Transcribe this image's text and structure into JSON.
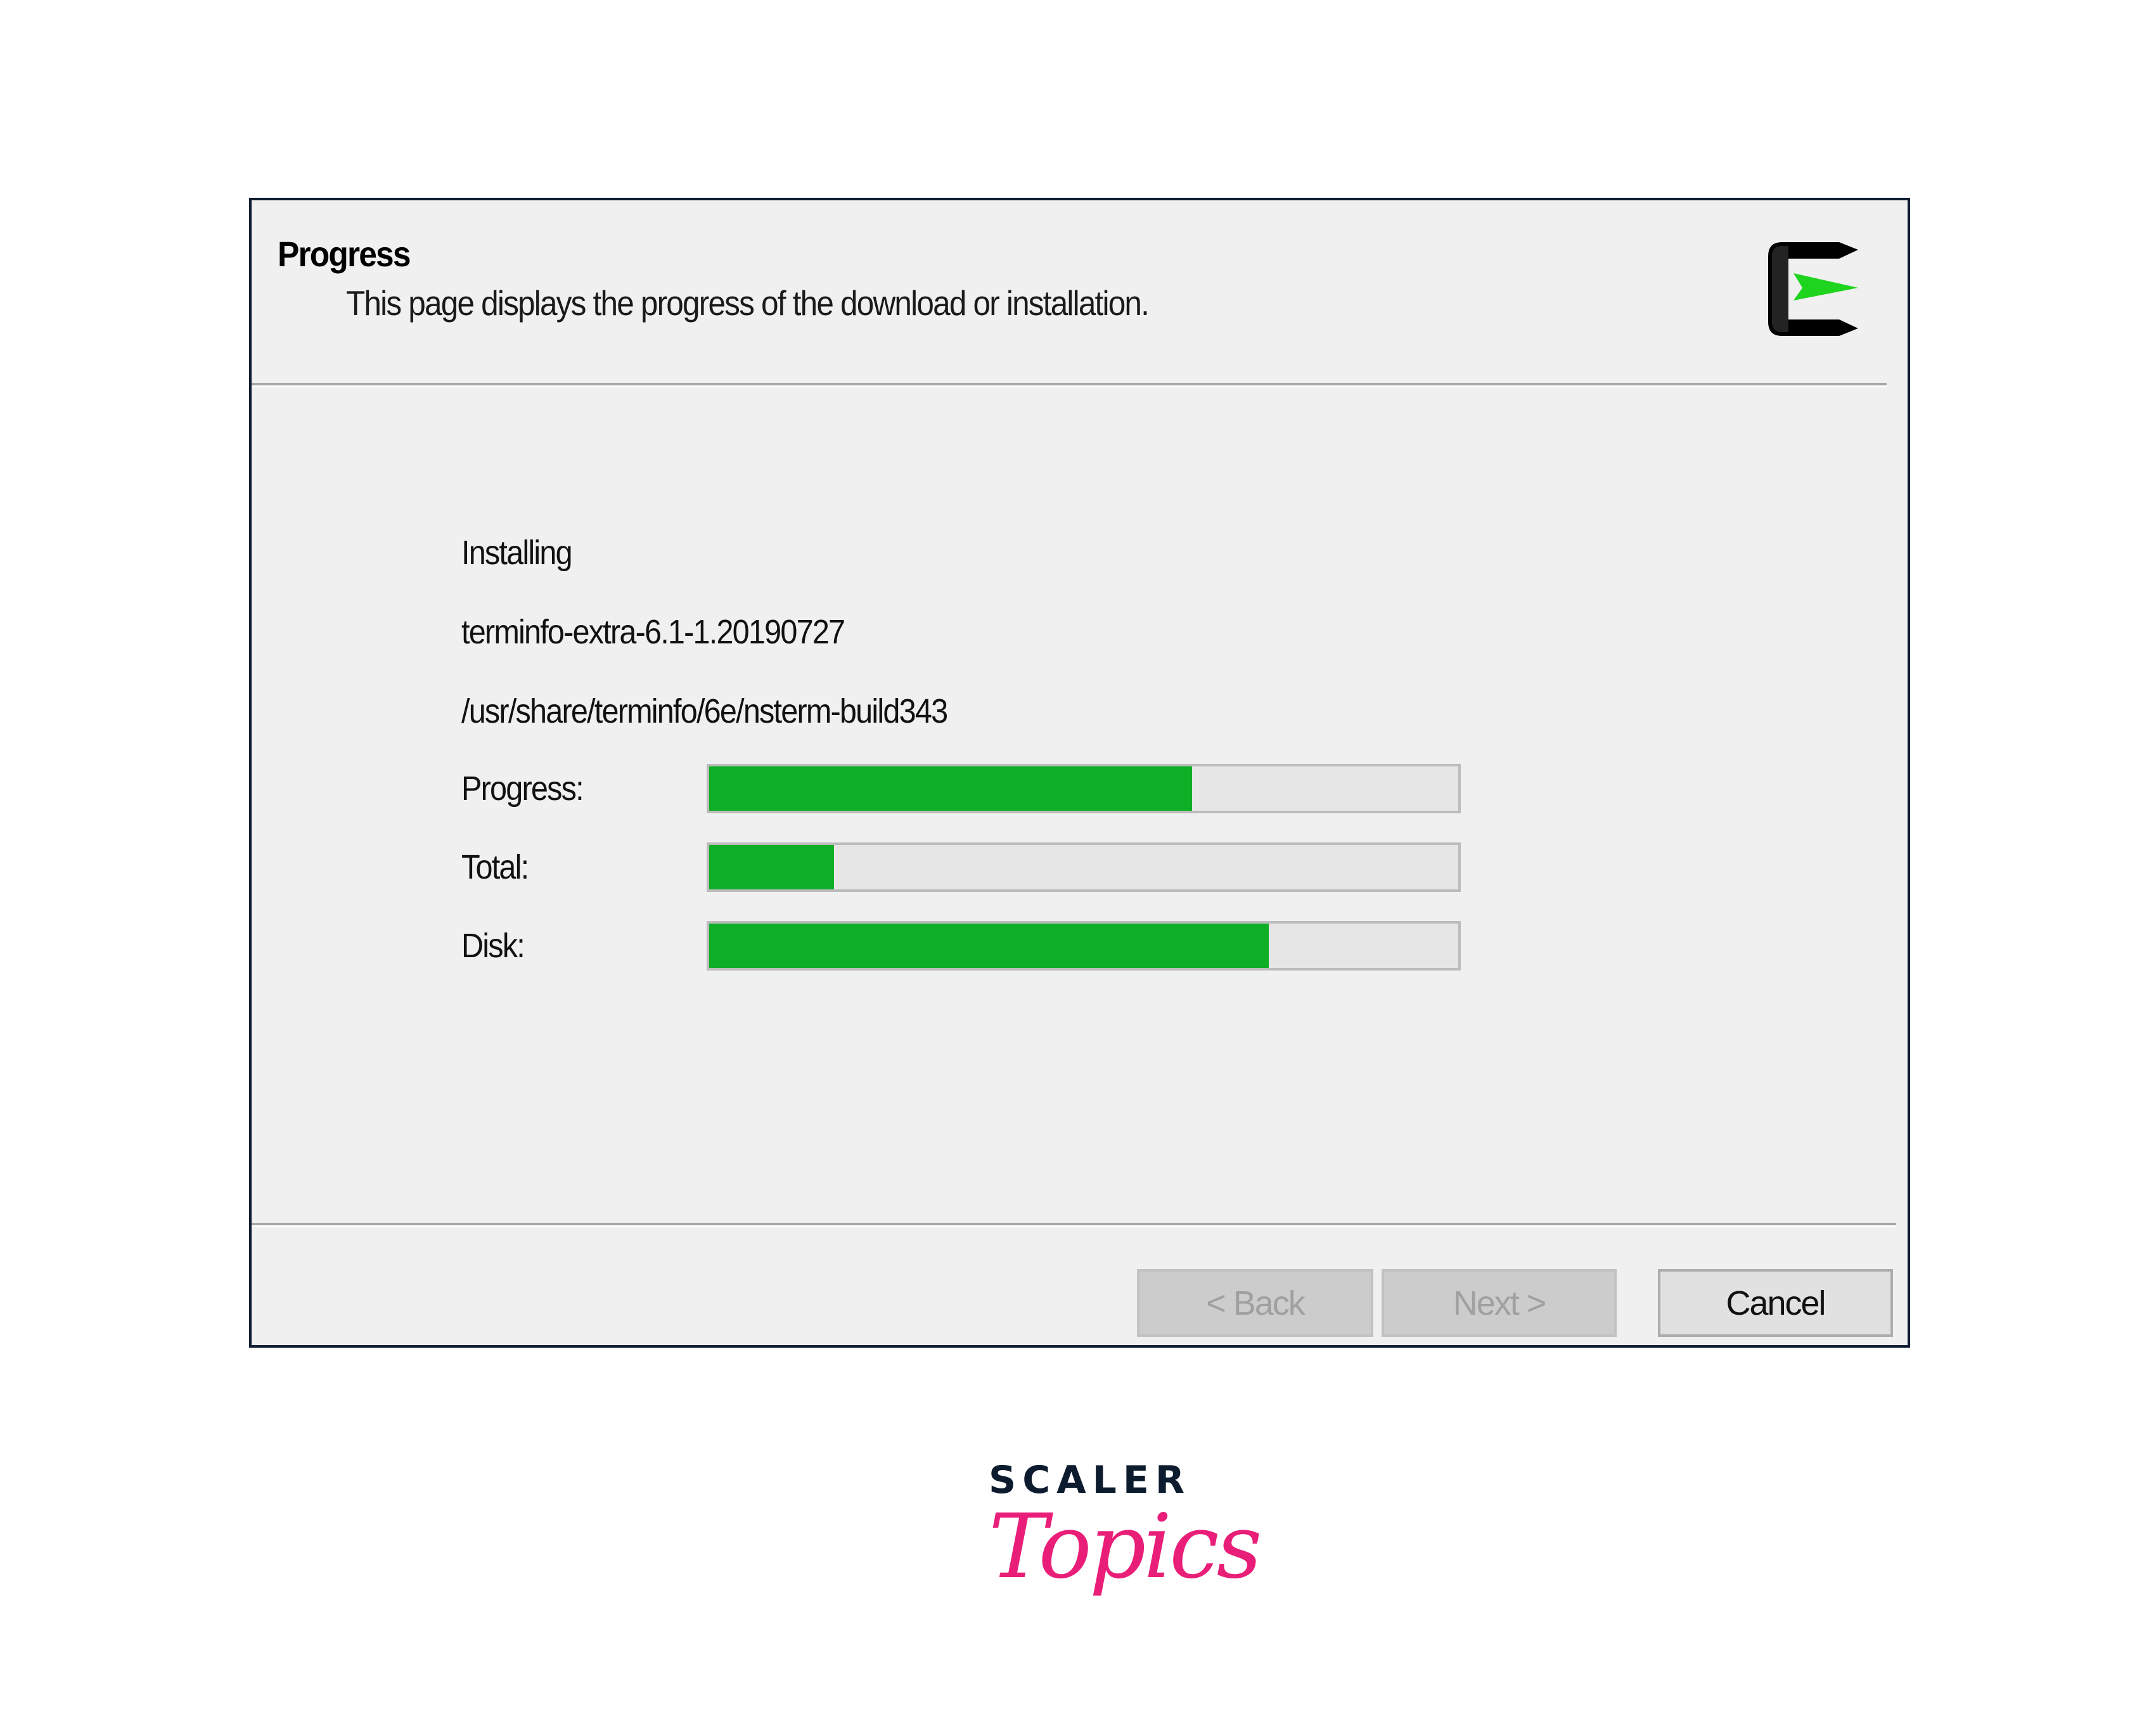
{
  "header": {
    "title": "Progress",
    "subtitle": "This page displays the progress of the download or installation.",
    "logo_icon": "cygwin-logo-icon"
  },
  "body": {
    "status": "Installing",
    "package": "terminfo-extra-6.1-1.20190727",
    "file_path": "/usr/share/terminfo/6e/nsterm-build343",
    "bars": [
      {
        "label": "Progress:",
        "fraction": 0.645
      },
      {
        "label": "Total:",
        "fraction": 0.167
      },
      {
        "label": "Disk:",
        "fraction": 0.747
      }
    ],
    "bar_color": "#0fae27"
  },
  "footer": {
    "back_label": "< Back",
    "next_label": "Next >",
    "cancel_label": "Cancel",
    "back_enabled": false,
    "next_enabled": false
  },
  "branding": {
    "line1": "SCALER",
    "line2": "Topics",
    "line1_color": "#0d1b2e",
    "line2_color": "#e91e78"
  }
}
